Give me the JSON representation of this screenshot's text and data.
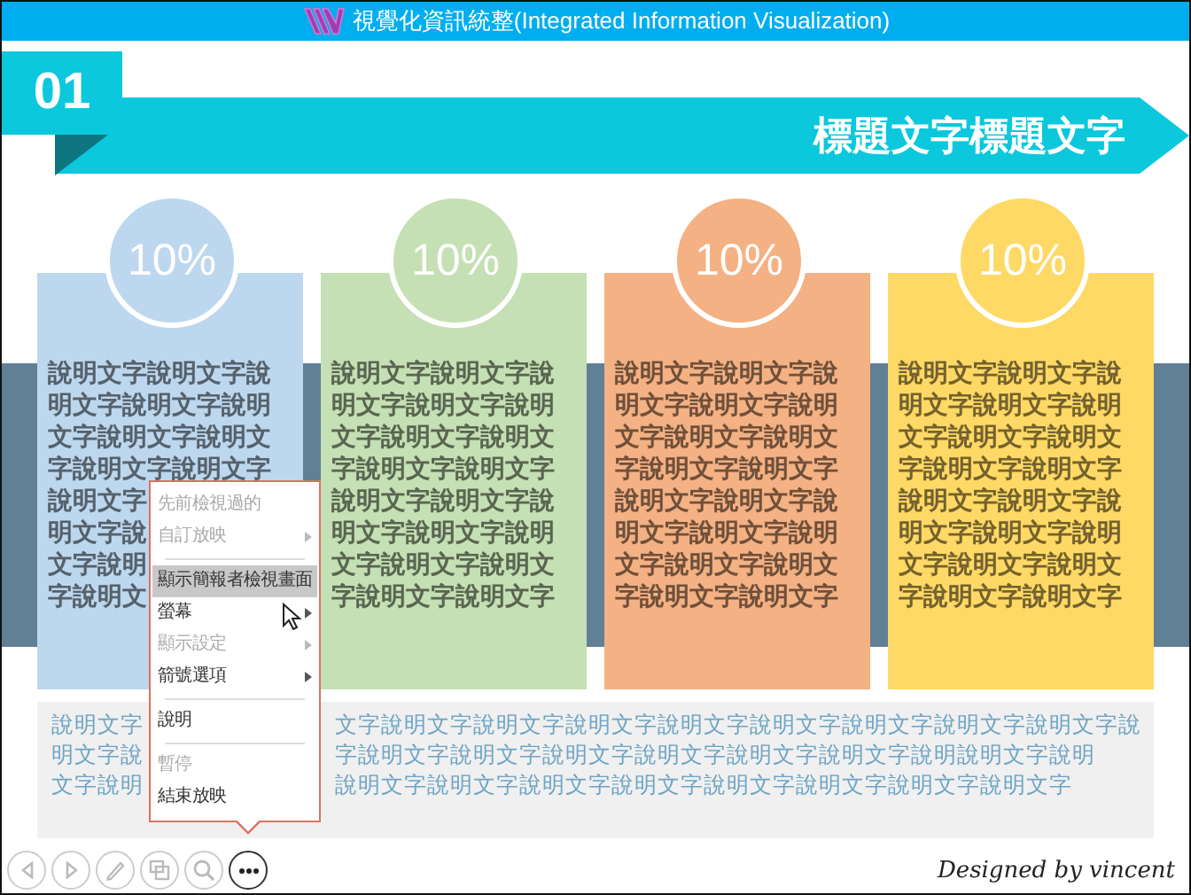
{
  "window": {
    "title": "視覺化資訊統整(Integrated Information Visualization)"
  },
  "slide": {
    "number": "01",
    "heading": "標題文字標題文字",
    "cards": [
      {
        "percent": "10%",
        "color": "#bdd7ee",
        "lines": [
          "說明文字說明文字說",
          "明文字說明文字說明",
          "文字說明文字說明文",
          "字說明文字說明文字",
          "說明文字",
          "明文字說",
          "文字說明",
          "字說明文"
        ]
      },
      {
        "percent": "10%",
        "color": "#c5e0b4",
        "lines": [
          "說明文字說明文字說",
          "明文字說明文字說明",
          "文字說明文字說明文",
          "字說明文字說明文字",
          "說明文字說明文字說",
          "明文字說明文字說明",
          "文字說明文字說明文",
          "字說明文字說明文字"
        ]
      },
      {
        "percent": "10%",
        "color": "#f4b183",
        "lines": [
          "說明文字說明文字說",
          "明文字說明文字說明",
          "文字說明文字說明文",
          "字說明文字說明文字",
          "說明文字說明文字說",
          "明文字說明文字說明",
          "文字說明文字說明文",
          "字說明文字說明文字"
        ]
      },
      {
        "percent": "10%",
        "color": "#ffd966",
        "lines": [
          "說明文字說明文字說",
          "明文字說明文字說明",
          "文字說明文字說明文",
          "字說明文字說明文字",
          "說明文字說明文字說",
          "明文字說明文字說明",
          "文字說明文字說明文",
          "字說明文字說明文字"
        ]
      }
    ],
    "summary_lines": [
      {
        "left": "說明文字",
        "right": "文字說明文字說明文字說明文字說明文字說明文字說明文字說明文字說明文字說"
      },
      {
        "left": "明文字說",
        "right": "字說明文字說明文字說明文字說明文字說明文字說明文字說明說明文字說明"
      },
      {
        "left": "文字說明",
        "right": "說明文字說明文字說明文字說明文字說明文字說明文字說明文字說明文字"
      }
    ],
    "credit": "Designed by vincent"
  },
  "context_menu": {
    "items": [
      {
        "kind": "item",
        "label": "先前檢視過的",
        "disabled": true,
        "submenu": false,
        "selected": false
      },
      {
        "kind": "item",
        "label": "自訂放映",
        "disabled": true,
        "submenu": true,
        "selected": false
      },
      {
        "kind": "divider"
      },
      {
        "kind": "item",
        "label": "顯示簡報者檢視畫面",
        "disabled": false,
        "submenu": false,
        "selected": true
      },
      {
        "kind": "item",
        "label": "螢幕",
        "disabled": false,
        "submenu": true,
        "selected": false
      },
      {
        "kind": "item",
        "label": "顯示設定",
        "disabled": true,
        "submenu": true,
        "selected": false
      },
      {
        "kind": "item",
        "label": "箭號選項",
        "disabled": false,
        "submenu": true,
        "selected": false
      },
      {
        "kind": "divider"
      },
      {
        "kind": "item",
        "label": "說明",
        "disabled": false,
        "submenu": false,
        "selected": false
      },
      {
        "kind": "divider"
      },
      {
        "kind": "item",
        "label": "暫停",
        "disabled": true,
        "submenu": false,
        "selected": false
      },
      {
        "kind": "item",
        "label": "結束放映",
        "disabled": false,
        "submenu": false,
        "selected": false
      }
    ]
  },
  "toolbar": [
    {
      "kind": "previous",
      "active": false
    },
    {
      "kind": "next",
      "active": false
    },
    {
      "kind": "pen",
      "active": false
    },
    {
      "kind": "slides",
      "active": false
    },
    {
      "kind": "zoom",
      "active": false
    },
    {
      "kind": "more",
      "active": true
    }
  ]
}
